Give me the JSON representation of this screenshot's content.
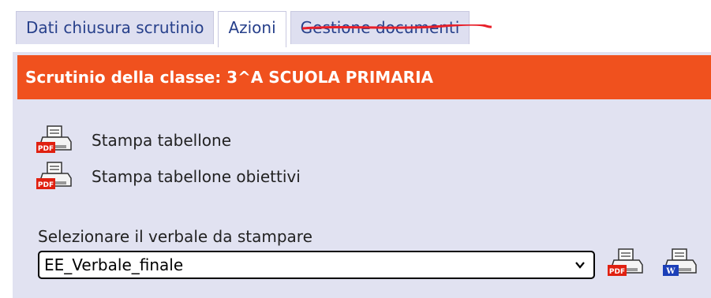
{
  "tabs": [
    {
      "label": "Dati chiusura scrutinio",
      "active": false
    },
    {
      "label": "Azioni",
      "active": true
    },
    {
      "label": "Gestione documenti",
      "active": false,
      "struck_through": true
    }
  ],
  "header": {
    "title": "Scrutinio della classe: 3^A SCUOLA PRIMARIA"
  },
  "actions": [
    {
      "label": "Stampa tabellone",
      "icon": "pdf-printer-icon"
    },
    {
      "label": "Stampa tabellone obiettivi",
      "icon": "pdf-printer-icon"
    }
  ],
  "verbale": {
    "label": "Selezionare il verbale da stampare",
    "selected": "EE_Verbale_finale"
  },
  "export_buttons": {
    "pdf": {
      "badge": "PDF",
      "icon": "pdf-printer-icon"
    },
    "word": {
      "badge": "W",
      "icon": "word-printer-icon"
    }
  },
  "colors": {
    "header_bg": "#f0511e",
    "panel_bg": "#e1e2f1",
    "tab_bg": "#dedff0",
    "tab_text": "#27408b",
    "strike": "#e8202a",
    "pdf_badge": "#e02010",
    "word_badge": "#1b3fb8"
  }
}
